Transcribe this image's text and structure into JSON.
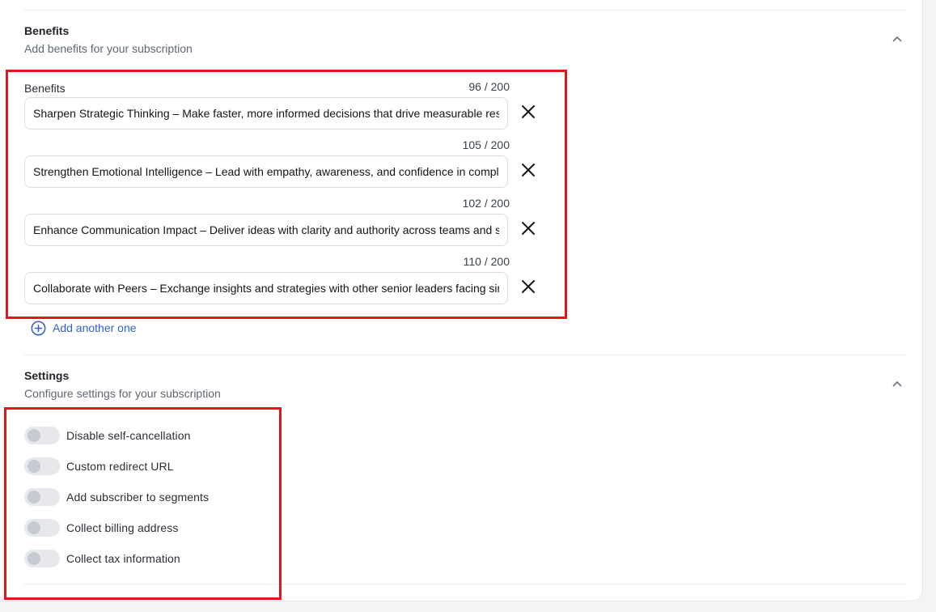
{
  "benefits_section": {
    "title": "Benefits",
    "subtitle": "Add benefits for your subscription",
    "field_label": "Benefits",
    "items": [
      {
        "value": "Sharpen Strategic Thinking – Make faster, more informed decisions that drive measurable results across your organization.",
        "counter": "96 / 200"
      },
      {
        "value": "Strengthen Emotional Intelligence – Lead with empathy, awareness, and confidence in complex situations and conversations.",
        "counter": "105 / 200"
      },
      {
        "value": "Enhance Communication Impact – Deliver ideas with clarity and authority across teams and stakeholders at every level.",
        "counter": "102 / 200"
      },
      {
        "value": "Collaborate with Peers – Exchange insights and strategies with other senior leaders facing similar challenges today.",
        "counter": "110 / 200"
      }
    ],
    "add_label": "Add another one"
  },
  "settings_section": {
    "title": "Settings",
    "subtitle": "Configure settings for your subscription",
    "toggles": [
      {
        "label": "Disable self-cancellation",
        "on": false
      },
      {
        "label": "Custom redirect URL",
        "on": false
      },
      {
        "label": "Add subscriber to segments",
        "on": false
      },
      {
        "label": "Collect billing address",
        "on": false
      },
      {
        "label": "Collect tax information",
        "on": false
      }
    ]
  },
  "colors": {
    "accent": "#2f5fd0",
    "highlight": "#e0161b",
    "toggle_off": "#e6e8eb"
  },
  "icons": {
    "collapse": "chevron-up-icon",
    "remove": "close-icon",
    "add": "plus-circle-icon"
  }
}
